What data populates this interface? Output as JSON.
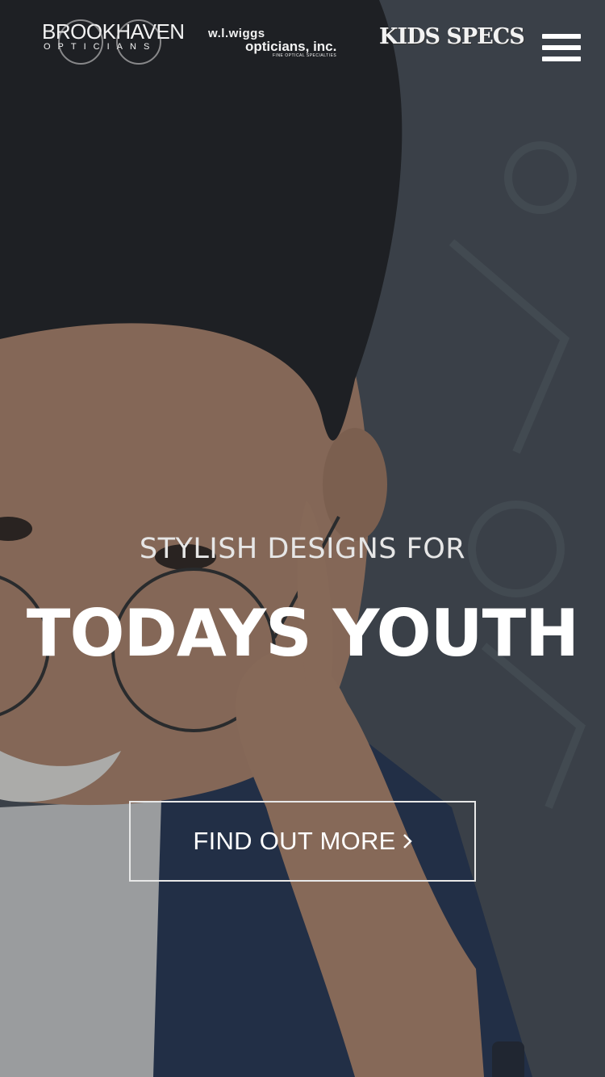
{
  "header": {
    "logos": {
      "brookhaven_main": "BROOKHAVEN",
      "brookhaven_sub": "OPTICIANS",
      "wiggs_top": "w.l.wiggs",
      "wiggs_bottom": "opticians, inc.",
      "wiggs_tagline": "FINE OPTICAL SPECIALTIES",
      "kids_specs": "KIDS SPECS"
    },
    "menu_icon": "hamburger-menu-icon"
  },
  "hero": {
    "tagline": "STYLISH DESIGNS FOR",
    "headline": "TODAYS YOUTH",
    "cta_label": "FIND OUT MORE",
    "cta_icon": "chevron-right-icon"
  },
  "colors": {
    "text": "#ffffff",
    "overlay": "#3b434c"
  }
}
